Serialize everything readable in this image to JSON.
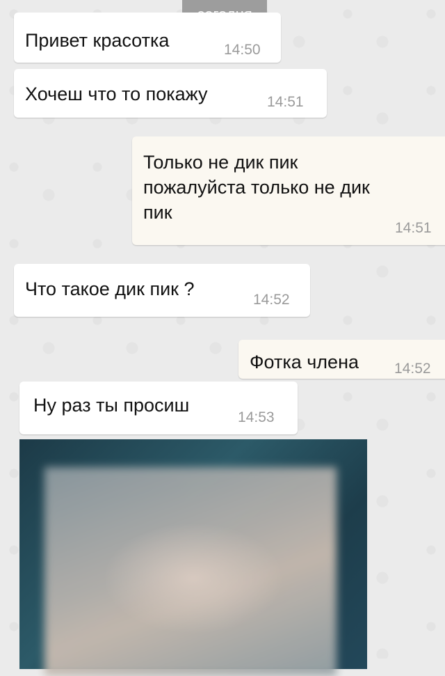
{
  "chat": {
    "date_label": "сегодня",
    "messages": [
      {
        "direction": "incoming",
        "text": "Привет красотка",
        "time": "14:50"
      },
      {
        "direction": "incoming",
        "text": "Хочеш что то покажу",
        "time": "14:51"
      },
      {
        "direction": "outgoing",
        "text": "Только не дик пик\nпожалуйста только не дик\nпик",
        "time": "14:51"
      },
      {
        "direction": "incoming",
        "text": "Что такое дик пик ?",
        "time": "14:52"
      },
      {
        "direction": "outgoing",
        "text": "Фотка члена",
        "time": "14:52"
      },
      {
        "direction": "incoming",
        "text": "Ну раз ты просиш",
        "time": "14:53"
      },
      {
        "direction": "incoming",
        "type": "image",
        "content": "blurred photo"
      }
    ]
  }
}
